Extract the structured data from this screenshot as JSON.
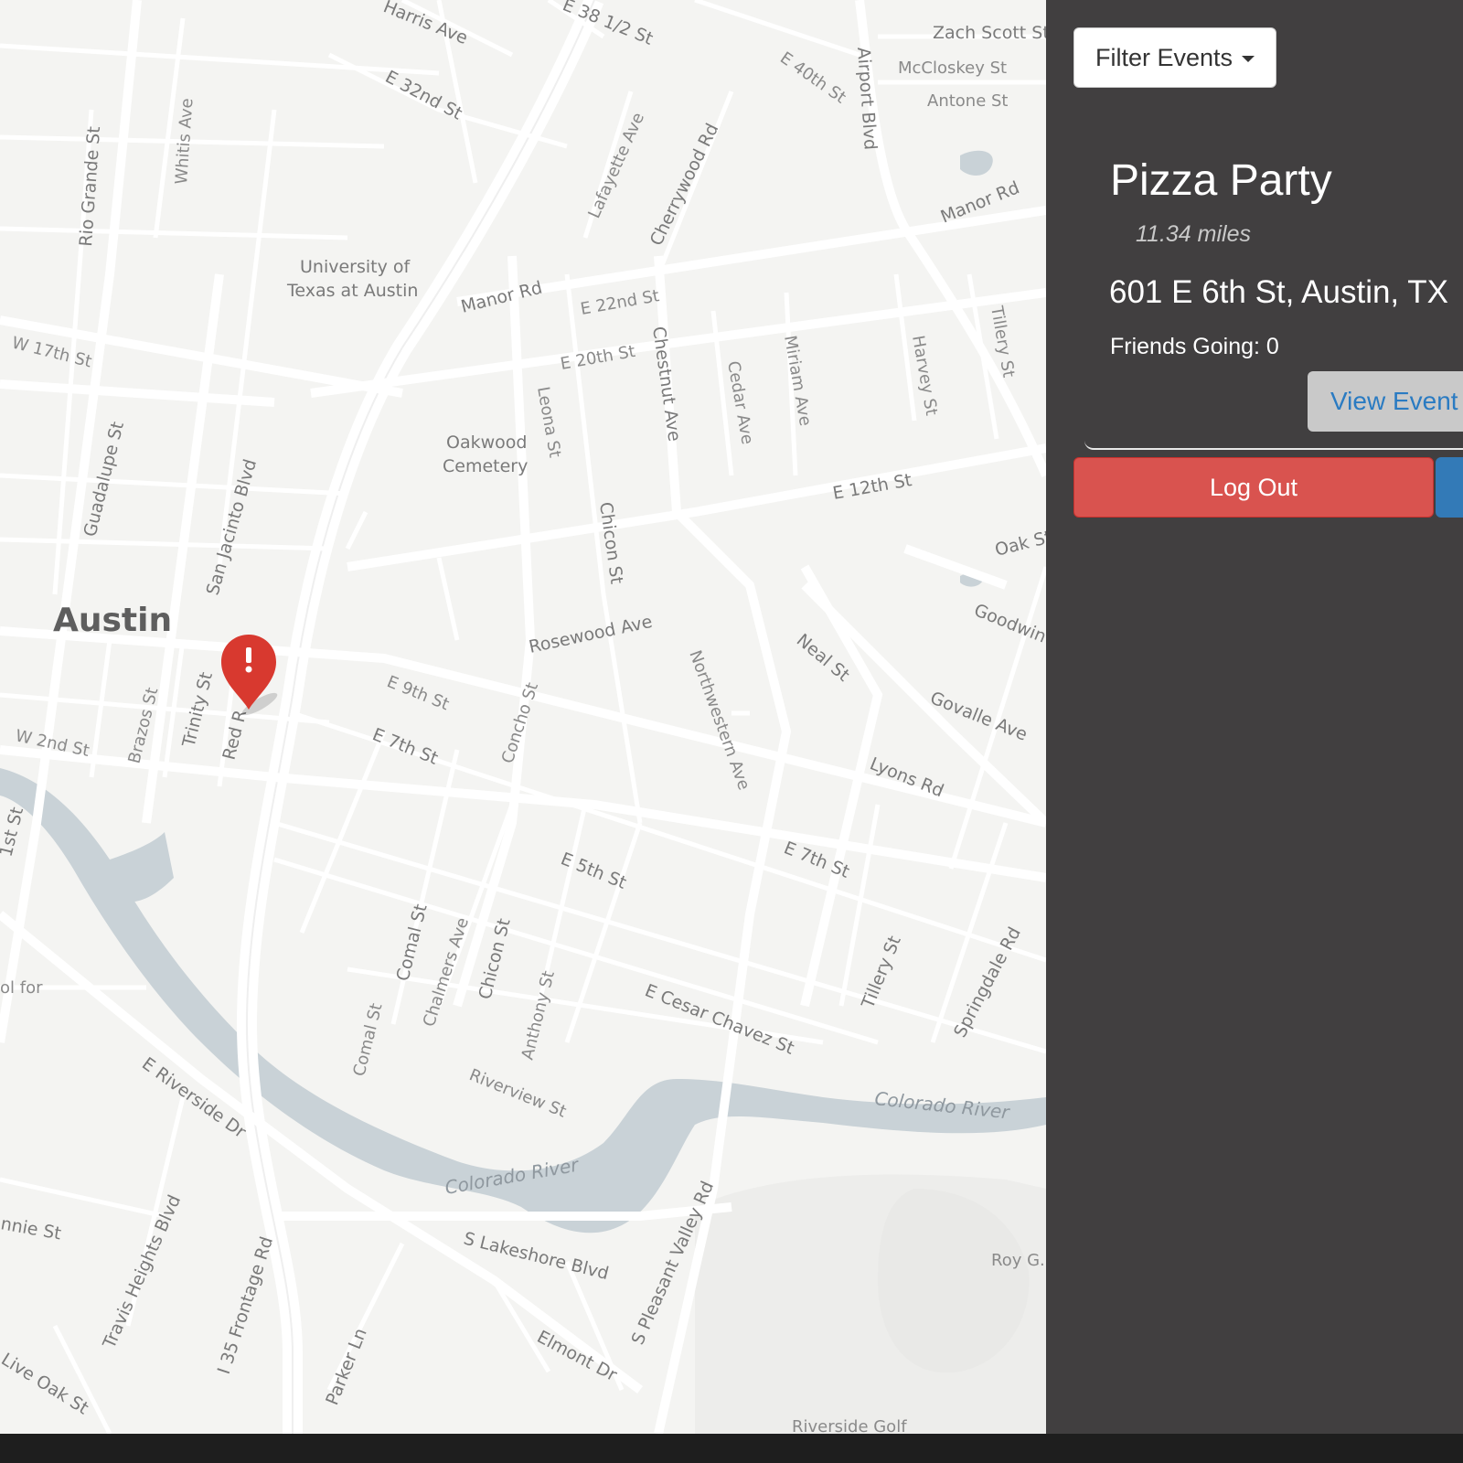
{
  "map": {
    "city_label": "Austin",
    "street_labels": [
      "Harris Ave",
      "E 38 1/2 St",
      "E 32nd St",
      "E 40th St",
      "Airport Blvd",
      "Zach Scott St",
      "McCloskey St",
      "Antone St",
      "Rio Grande St",
      "Whitis Ave",
      "Lafayette Ave",
      "Cherrywood Rd",
      "Manor Rd",
      "Manor Rd",
      "University of",
      "Texas at Austin",
      "E 22nd St",
      "W 17th St",
      "E 20th St",
      "Chestnut Ave",
      "Leona St",
      "Cedar Ave",
      "Miriam Ave",
      "Harvey St",
      "Tillery St",
      "Guadalupe St",
      "Oakwood",
      "Cemetery",
      "San Jacinto Blvd",
      "E 12th St",
      "Chicon St",
      "Oak St",
      "Rosewood Ave",
      "Goodwin",
      "Neal St",
      "Northwestern Ave",
      "Govalle Ave",
      "E 9th St",
      "Concho St",
      "Trinity St",
      "Brazos St",
      "Red R",
      "W 2nd St",
      "E 7th St",
      "Lyons Rd",
      "E 5th St",
      "E 7th St",
      "1st St",
      "Comal St",
      "Chalmers Ave",
      "Chicon St",
      "Anthony St",
      "Comal St",
      "Tillery St",
      "Springdale Rd",
      "E Cesar Chavez St",
      "ol for",
      "E Riverside Dr",
      "Riverview St",
      "Travis Heights Blvd",
      "I 35 Frontage Rd",
      "S Lakeshore Blvd",
      "S Pleasant Valley Rd",
      "nnie St",
      "Parker Ln",
      "Elmont Dr",
      "Live Oak St",
      "Roy G.",
      "Riverside Golf"
    ],
    "water_labels": [
      "Colorado River",
      "Colorado River"
    ],
    "marker_icon": "map-marker-exclamation-icon",
    "colors": {
      "land": "#f4f4f2",
      "road": "#ffffff",
      "water": "#c9d2d7",
      "marker": "#d8392f"
    }
  },
  "sidebar": {
    "filter_label": "Filter Events",
    "event": {
      "title": "Pizza Party",
      "distance": "11.34 miles",
      "address": "601 E 6th St, Austin, TX",
      "friends_label": "Friends Going: ",
      "friends_count": "0",
      "view_label": "View Event"
    },
    "logout_label": "Log Out",
    "colors": {
      "panel": "#413f40",
      "logout": "#d9534f",
      "view_text": "#2a7bc2",
      "blue_button": "#337ab7"
    }
  }
}
